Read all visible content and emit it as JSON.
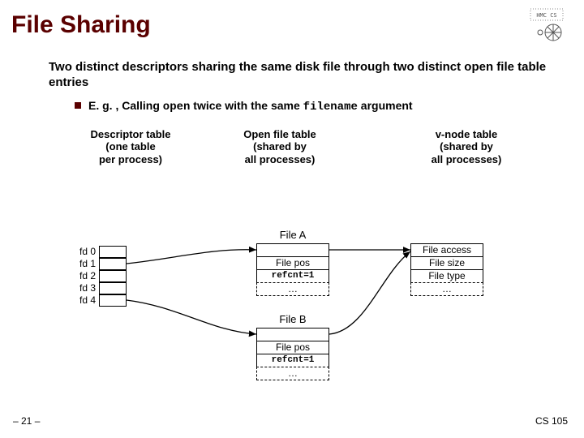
{
  "title": "File Sharing",
  "subhead": "Two distinct descriptors sharing the same disk file through two distinct open file table entries",
  "bullet_pre": "E. g. , Calling ",
  "bullet_code1": "open",
  "bullet_mid": " twice with the same ",
  "bullet_code2": "filename",
  "bullet_post": " argument",
  "col1_l1": "Descriptor table",
  "col1_l2": "(one table",
  "col1_l3": "per process)",
  "col2_l1": "Open file table",
  "col2_l2": "(shared by",
  "col2_l3": "all processes)",
  "col3_l1": "v-node table",
  "col3_l2": "(shared by",
  "col3_l3": "all processes)",
  "fd0": "fd 0",
  "fd1": "fd 1",
  "fd2": "fd 2",
  "fd3": "fd 3",
  "fd4": "fd 4",
  "fileA": "File A",
  "fileB": "File B",
  "filepos": "File pos",
  "refcnt": "refcnt=1",
  "dots": "…",
  "fileaccess": "File access",
  "filesize": "File size",
  "filetype": "File type",
  "slide_no": "– 21 –",
  "course": "CS 105"
}
